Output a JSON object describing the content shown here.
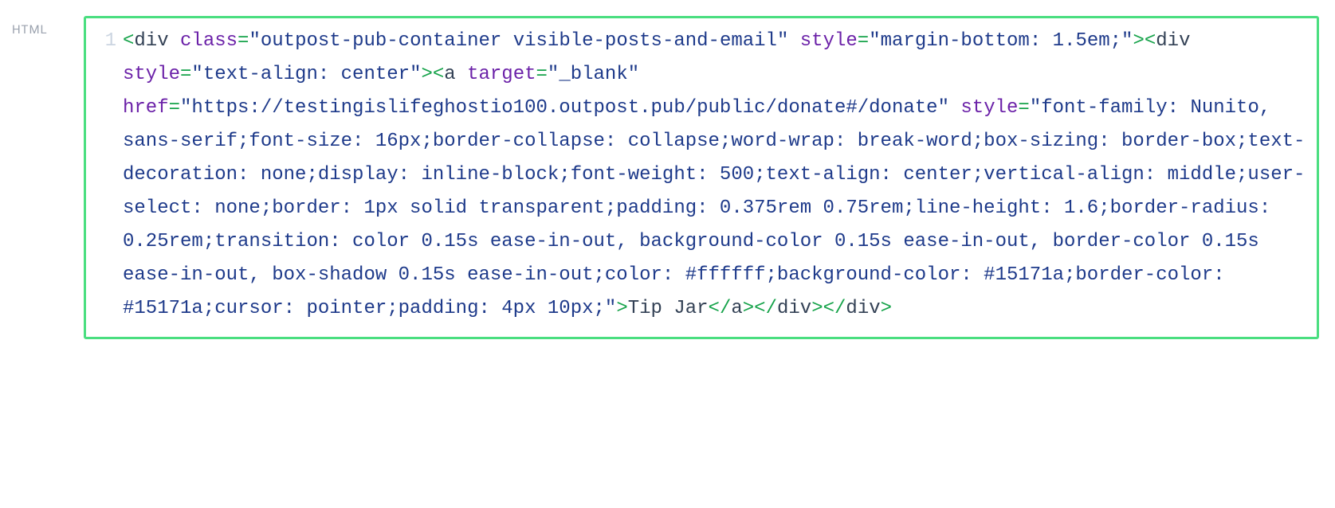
{
  "lang_label": "HTML",
  "line_number": "1",
  "code": {
    "t1_open": "<",
    "t1_tag": "div",
    "t1_sp": " ",
    "t1_attr1": "class",
    "t1_eq": "=",
    "t1_val1": "\"outpost-pub-container visible-posts-and-email\"",
    "t1_sp2": " ",
    "t1_attr2": "style",
    "t1_val2": "\"margin-bottom: 1.5em;\"",
    "t1_close": ">",
    "t2_open": "<",
    "t2_tag": "div",
    "t2_sp": " ",
    "t2_attr1": "style",
    "t2_val1": "\"text-align: center\"",
    "t2_close": ">",
    "t3_open": "<",
    "t3_tag": "a",
    "t3_sp": " ",
    "t3_attr1": "target",
    "t3_val1": "\"_blank\"",
    "t3_sp2": " ",
    "t3_attr2": "href",
    "t3_val2": "\"https://testingislifeghostio100.outpost.pub/public/donate#/donate\"",
    "t3_sp3": " ",
    "t3_attr3": "style",
    "t3_val3": "\"font-family: Nunito, sans-serif;font-size: 16px;border-collapse: collapse;word-wrap: break-word;box-sizing: border-box;text-decoration: none;display: inline-block;font-weight: 500;text-align: center;vertical-align: middle;user-select: none;border: 1px solid transparent;padding: 0.375rem 0.75rem;line-height: 1.6;border-radius: 0.25rem;transition: color 0.15s ease-in-out, background-color 0.15s ease-in-out, border-color 0.15s ease-in-out, box-shadow 0.15s ease-in-out;color: #ffffff;background-color: #15171a;border-color: #15171a;cursor: pointer;padding: 4px 10px;\"",
    "t3_close": ">",
    "t3_text": "Tip Jar",
    "t3_endopen": "</",
    "t3_endtag": "a",
    "t3_endclose": ">",
    "t2_endopen": "</",
    "t2_endtag": "div",
    "t2_endclose": ">",
    "t1_endopen": "</",
    "t1_endtag": "div",
    "t1_endclose": ">"
  }
}
